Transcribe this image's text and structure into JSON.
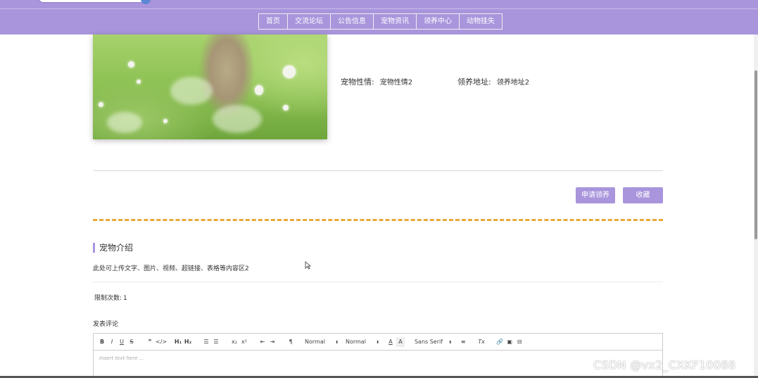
{
  "nav": {
    "items": [
      "首页",
      "交流论坛",
      "公告信息",
      "宠物资讯",
      "领养中心",
      "动物挂失"
    ]
  },
  "pet": {
    "temperament_label": "宠物性情:",
    "temperament_value": "宠物性情2",
    "address_label": "领养地址:",
    "address_value": "领养地址2"
  },
  "actions": {
    "adopt_label": "申请领养",
    "favorite_label": "收藏"
  },
  "intro": {
    "title": "宠物介绍",
    "text": "此处可上传文字、图片、视频、超链接、表格等内容区2"
  },
  "limit": {
    "label": "限制次数:",
    "value": "1"
  },
  "comment": {
    "label": "发表评论"
  },
  "editor": {
    "toolbar": {
      "bold": "B",
      "italic": "I",
      "underline": "U",
      "strike": "S",
      "blockquote": "❞",
      "code": "</>",
      "h1": "H₁",
      "h2": "H₂",
      "ordered_list": "☰",
      "bullet_list": "☰",
      "subscript": "x₂",
      "superscript": "x²",
      "outdent": "⇤",
      "indent": "⇥",
      "direction": "¶",
      "size_picker": "Normal",
      "header_picker": "Normal",
      "font_color": "A",
      "background": "A",
      "font_picker": "Sans Serif",
      "align": "≡",
      "clean": "Tx",
      "link": "🔗",
      "image": "▣",
      "video": "⊟"
    },
    "placeholder": "Insert text here ..."
  },
  "watermark": "CSDN @vx2_CXKF10088",
  "colors": {
    "accent": "#a995dc",
    "divider_dashed": "#e8a83a"
  }
}
